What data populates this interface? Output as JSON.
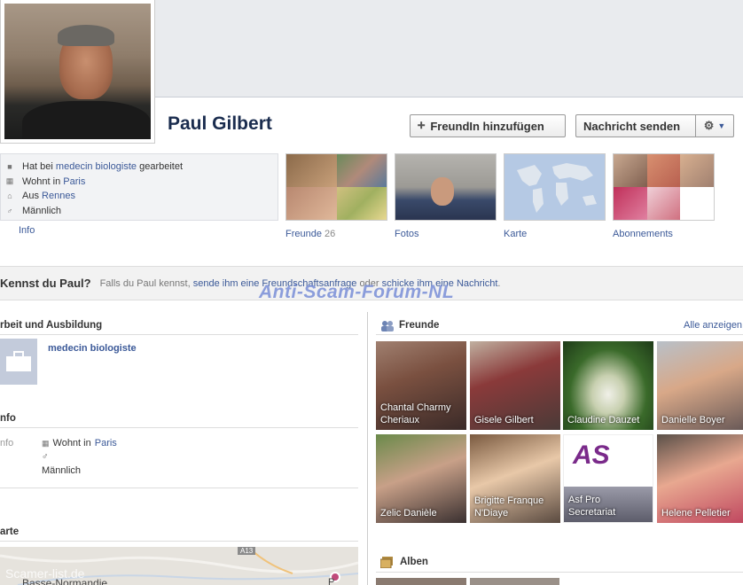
{
  "profile": {
    "name": "Paul Gilbert",
    "add_friend_label": "FreundIn hinzufügen",
    "message_label": "Nachricht senden"
  },
  "about": {
    "worked_prefix": "Hat bei",
    "worked_place": "medecin biologiste",
    "worked_suffix": "gearbeitet",
    "lives_prefix": "Wohnt in",
    "lives_place": "Paris",
    "from_prefix": "Aus",
    "from_place": "Rennes",
    "gender": "Männlich",
    "info_link": "Info"
  },
  "tiles": {
    "friends_label": "Freunde",
    "friends_count": "26",
    "photos_label": "Fotos",
    "map_label": "Karte",
    "subs_label": "Abonnements"
  },
  "kennst": {
    "title": "Kennst du Paul?",
    "text_1": "Falls du Paul kennst,",
    "link_1": "sende ihm eine Freundschaftsanfrage",
    "text_2": "oder",
    "link_2": "schicke ihm eine Nachricht",
    "text_3": "."
  },
  "watermark": "Anti-Scam-Forum-NL",
  "left": {
    "work_title": "rbeit und Ausbildung",
    "work_item": "medecin biologiste",
    "info_title": "nfo",
    "info_label": "nfo",
    "lives_prefix": "Wohnt in",
    "lives_place": "Paris",
    "gender": "Männlich",
    "map_title": "arte",
    "map_region": "Basse-Normandie",
    "map_road": "A13",
    "map_watermark": "Scamer-list.de",
    "map_city_fragment": "P"
  },
  "friends": {
    "title": "Freunde",
    "see_all": "Alle anzeigen",
    "items": [
      {
        "name": "Chantal Charmy Cheriaux"
      },
      {
        "name": "Gisele Gilbert"
      },
      {
        "name": "Claudine Dauzet"
      },
      {
        "name": "Danielle Boyer"
      },
      {
        "name": "Zelic Danièle"
      },
      {
        "name": "Brigitte Franque N'Diaye"
      },
      {
        "name": "Asf Pro Secretariat"
      },
      {
        "name": "Helene Pelletier"
      }
    ]
  },
  "albums": {
    "title": "Alben"
  },
  "colors": {
    "link": "#3b5998",
    "watermark": "#7a8fd8",
    "title": "#1a2c4e"
  }
}
